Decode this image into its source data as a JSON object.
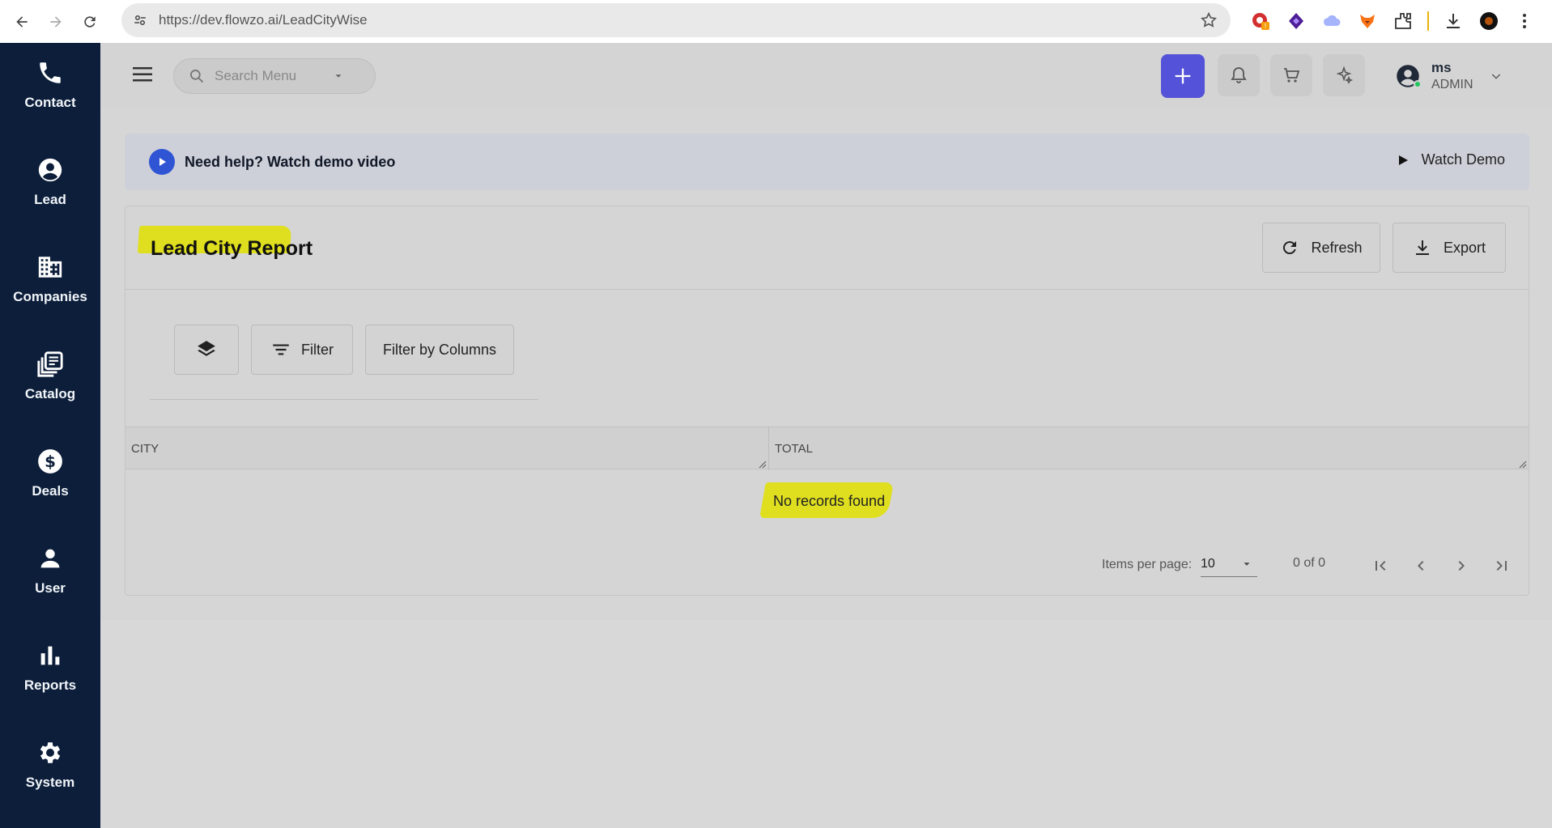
{
  "browser": {
    "url": "https://dev.flowzo.ai/LeadCityWise"
  },
  "sidebar": {
    "items": [
      {
        "label": "Contact",
        "icon": "phone-icon"
      },
      {
        "label": "Lead",
        "icon": "account-circle-icon"
      },
      {
        "label": "Companies",
        "icon": "building-icon"
      },
      {
        "label": "Catalog",
        "icon": "library-icon"
      },
      {
        "label": "Deals",
        "icon": "dollar-circle-icon"
      },
      {
        "label": "User",
        "icon": "person-icon"
      },
      {
        "label": "Reports",
        "icon": "bar-chart-icon"
      },
      {
        "label": "System",
        "icon": "gear-icon"
      }
    ]
  },
  "topbar": {
    "search_placeholder": "Search Menu",
    "user": {
      "name": "ms",
      "role": "ADMIN"
    },
    "accent_color": "#5352d8"
  },
  "help_banner": {
    "text": "Need help? Watch demo video",
    "watch_label": "Watch Demo"
  },
  "report": {
    "title": "Lead City Report",
    "refresh_label": "Refresh",
    "export_label": "Export",
    "filter_label": "Filter",
    "filter_columns_label": "Filter by Columns",
    "columns": [
      "CITY",
      "TOTAL"
    ],
    "empty_message": "No records found",
    "pagination": {
      "items_per_page_label": "Items per page:",
      "items_per_page": "10",
      "range": "0 of 0"
    }
  }
}
